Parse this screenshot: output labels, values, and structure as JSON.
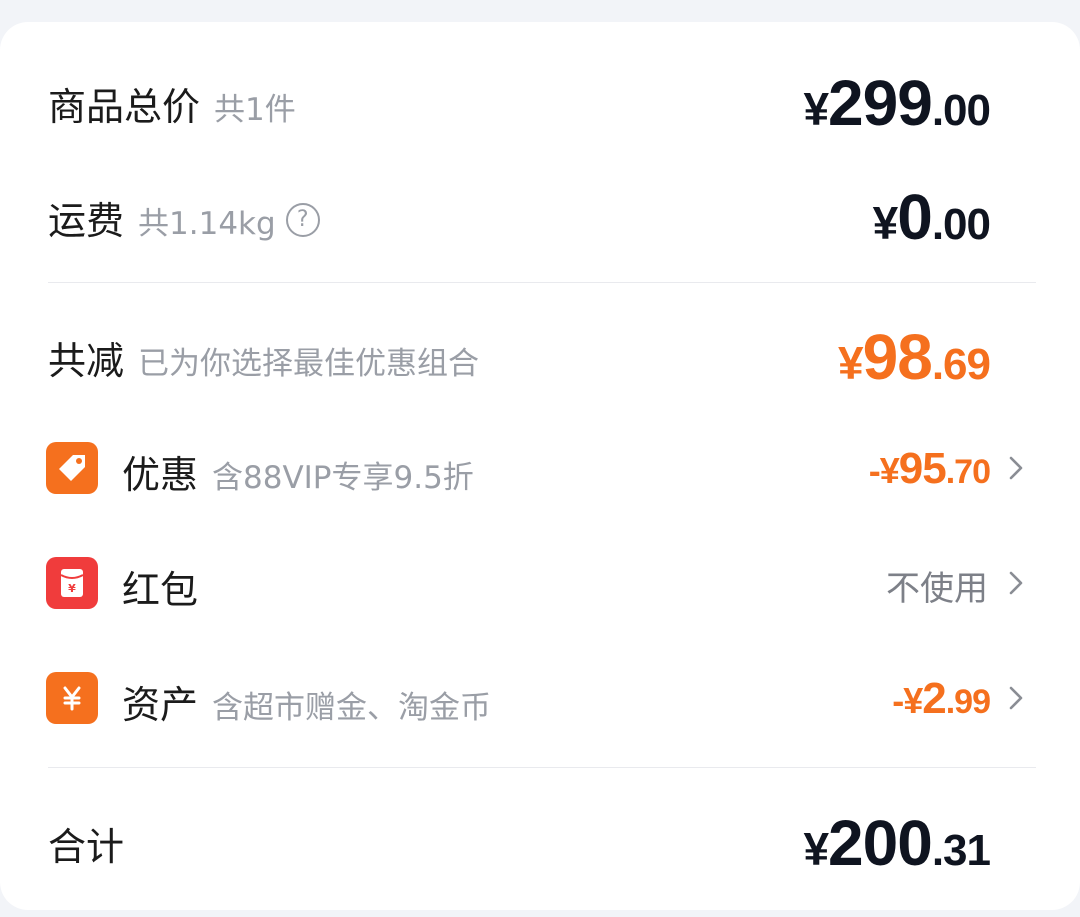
{
  "goods_total": {
    "label": "商品总价",
    "sub": "共1件",
    "currency": "¥",
    "integer": "299",
    "decimal": ".00"
  },
  "shipping": {
    "label": "运费",
    "sub": "共1.14kg",
    "help_icon_glyph": "?",
    "help_icon": "help-circle-icon",
    "currency": "¥",
    "integer": "0",
    "decimal": ".00"
  },
  "total_discount": {
    "label": "共减",
    "sub": "已为你选择最佳优惠组合",
    "currency": "¥",
    "integer": "98",
    "decimal": ".69"
  },
  "coupon": {
    "icon": "tag-icon",
    "label": "优惠",
    "sub": "含88VIP专享9.5折",
    "prefix": "-¥",
    "integer": "95",
    "decimal": ".70"
  },
  "red_packet": {
    "icon": "red-envelope-icon",
    "label": "红包",
    "status": "不使用"
  },
  "assets": {
    "icon": "yen-coin-icon",
    "label": "资产",
    "sub": "含超市赠金、淘金币",
    "prefix": "-¥",
    "integer": "2",
    "decimal": ".99"
  },
  "total": {
    "label": "合计",
    "currency": "¥",
    "integer": "200",
    "decimal": ".31"
  },
  "colors": {
    "accent_orange": "#f5701e",
    "red_packet": "#f03c3c",
    "text_dark": "#0f1420",
    "text_sub": "#9a9ea6"
  }
}
